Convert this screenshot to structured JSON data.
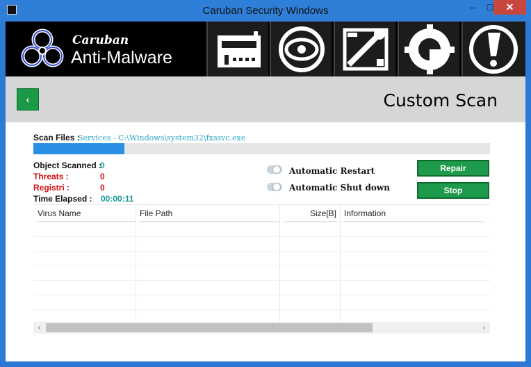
{
  "window": {
    "title": "Caruban Security Windows",
    "minimize_glyph": "–",
    "maximize_glyph": "□",
    "close_glyph": "✕"
  },
  "logo": {
    "line1": "Caruban",
    "line2": "Anti-Malware"
  },
  "nav": [
    {
      "icon": "building-icon"
    },
    {
      "icon": "scan-target-icon"
    },
    {
      "icon": "tools-icon"
    },
    {
      "icon": "gear-update-icon"
    },
    {
      "icon": "exclamation-icon"
    }
  ],
  "header": {
    "back_glyph": "‹",
    "title": "Custom Scan"
  },
  "scan": {
    "label": "Scan Files :",
    "current_file": "Services - C:\\Windows\\system32\\fxssvc.exe",
    "progress": 0.2
  },
  "stats": {
    "object_scanned_label": "Object Scanned :",
    "object_scanned_value": "0",
    "threats_label": "Threats :",
    "threats_value": "0",
    "registri_label": "Registri :",
    "registri_value": "0",
    "time_label": "Time Elapsed :",
    "time_value": "00:00:11"
  },
  "options": {
    "restart_label": "Automatic  Restart",
    "shutdown_label": "Automatic Shut down"
  },
  "buttons": {
    "repair": "Repair",
    "stop": "Stop"
  },
  "table": {
    "columns": [
      "Virus Name",
      "File Path",
      "Size[B]",
      "Information"
    ],
    "rows": []
  },
  "scrollbar": {
    "left_arrow": "‹",
    "right_arrow": "›"
  },
  "colors": {
    "accent_green": "#1d9a4b",
    "titlebar_blue": "#2f7fd8",
    "progress_blue": "#2b8fe6",
    "threat_red": "#d01010",
    "value_teal": "#1a9a98"
  }
}
